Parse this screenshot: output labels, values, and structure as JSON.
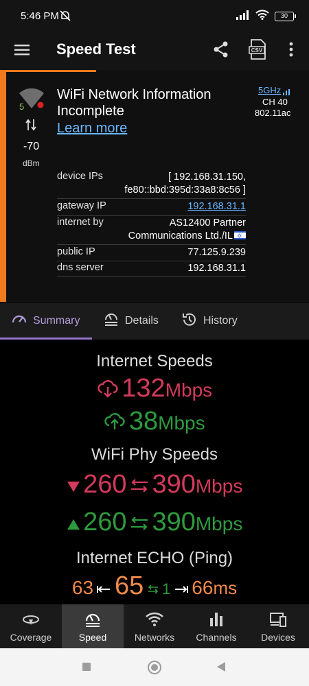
{
  "status_bar": {
    "time": "5:46 PM",
    "battery": "30"
  },
  "app_bar": {
    "title": "Speed Test"
  },
  "network_card": {
    "title": "WiFi Network Information Incomplete",
    "learn_more": "Learn more",
    "band": "5GHz",
    "channel": "CH 40",
    "standard": "802.11ac",
    "wifi_band_number": "5",
    "signal_value": "-70",
    "signal_unit": "dBm",
    "rows": [
      {
        "key": "device IPs",
        "value_line1": "[ 192.168.31.150,",
        "value_line2": "fe80::bbd:395d:33a8:8c56 ]"
      },
      {
        "key": "gateway IP",
        "value_line1": "192.168.31.1"
      },
      {
        "key": "internet by",
        "value_line1": "AS12400 Partner",
        "value_line2": "Communications Ltd./IL"
      },
      {
        "key": "public IP",
        "value_line1": "77.125.9.239"
      },
      {
        "key": "dns server",
        "value_line1": "192.168.31.1"
      }
    ]
  },
  "tabs": [
    {
      "label": "Summary",
      "active": true
    },
    {
      "label": "Details",
      "active": false
    },
    {
      "label": "History",
      "active": false
    }
  ],
  "summary": {
    "internet_speeds_label": "Internet Speeds",
    "download_value": "132",
    "download_unit": "Mbps",
    "upload_value": "38",
    "upload_unit": "Mbps",
    "phy_label": "WiFi Phy Speeds",
    "phy_down_a": "260",
    "phy_down_b": "390",
    "phy_up_a": "260",
    "phy_up_b": "390",
    "phy_unit": "Mbps",
    "ping_label": "Internet ECHO (Ping)",
    "ping_min": "63",
    "ping_avg": "65",
    "ping_jitter": "1",
    "ping_max": "66",
    "ping_unit": "ms"
  },
  "bottom_nav": [
    {
      "label": "Coverage",
      "icon": "coverage-icon"
    },
    {
      "label": "Speed",
      "icon": "speedometer-icon",
      "active": true
    },
    {
      "label": "Networks",
      "icon": "wifi-icon"
    },
    {
      "label": "Channels",
      "icon": "bar-chart-icon"
    },
    {
      "label": "Devices",
      "icon": "devices-icon"
    }
  ],
  "colors": {
    "accent_orange": "#f07a1d",
    "download_red": "#d43a5b",
    "upload_green": "#2e9a3e",
    "ping_orange": "#f08a4b",
    "tab_active": "#b39ddb",
    "link_blue": "#6ab7ff"
  }
}
